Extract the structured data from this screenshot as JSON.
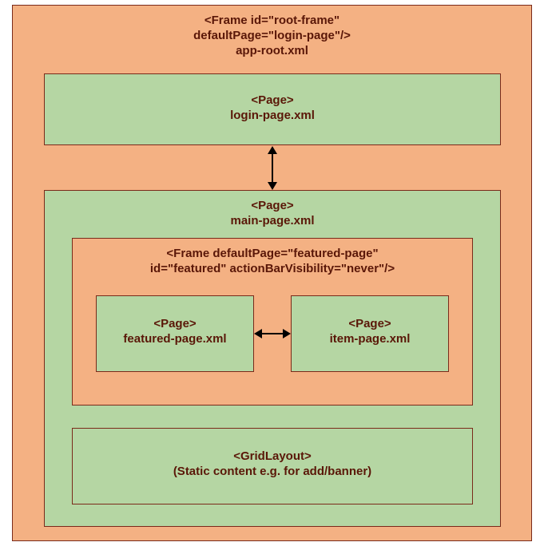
{
  "root": {
    "title_l1": "<Frame id=\"root-frame\"",
    "title_l2": "defaultPage=\"login-page\"/>",
    "title_l3": "app-root.xml",
    "login": {
      "l1": "<Page>",
      "l2": "login-page.xml"
    },
    "main": {
      "l1": "<Page>",
      "l2": "main-page.xml",
      "frame": {
        "l1": "<Frame defaultPage=\"featured-page\"",
        "l2": "id=\"featured\" actionBarVisibility=\"never\"/>",
        "featured": {
          "l1": "<Page>",
          "l2": "featured-page.xml"
        },
        "item": {
          "l1": "<Page>",
          "l2": "item-page.xml"
        }
      },
      "grid": {
        "l1": "<GridLayout>",
        "l2": "(Static content e.g. for add/banner)"
      }
    }
  }
}
